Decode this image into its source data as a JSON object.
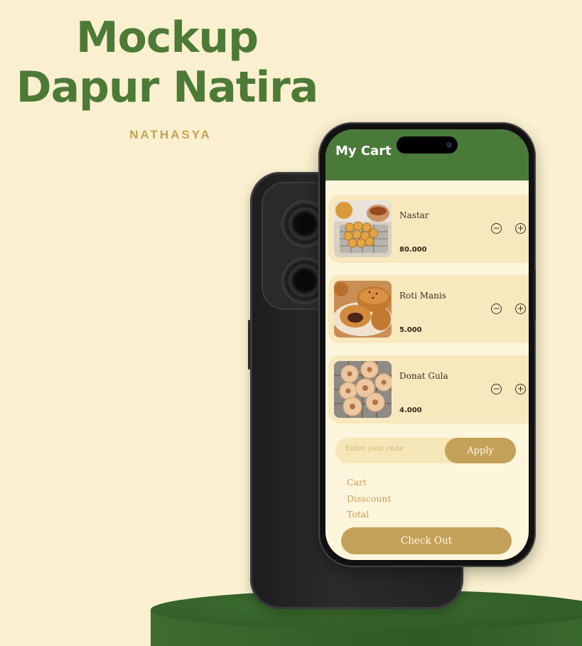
{
  "poster": {
    "title_line1": "Mockup",
    "title_line2": "Dapur Natira",
    "subtitle": "NATHASYA"
  },
  "app": {
    "header_title": "My Cart",
    "cart_items": [
      {
        "name": "Nastar",
        "price": "80.000",
        "image": "nastar-cookies-photo"
      },
      {
        "name": "Roti Manis",
        "price": "5.000",
        "image": "sweet-bread-photo"
      },
      {
        "name": "Donat Gula",
        "price": "4.000",
        "image": "sugar-donut-photo"
      }
    ],
    "quantity_controls": {
      "minus": "−",
      "plus": "+"
    },
    "promo": {
      "placeholder": "Enter your code",
      "apply_label": "Apply"
    },
    "summary": {
      "cart_label": "Cart",
      "discount_label": "Disscount",
      "total_label": "Total"
    },
    "checkout_label": "Check Out"
  },
  "colors": {
    "background": "#faf0cf",
    "brand_green": "#4a7a3a",
    "accent_gold": "#c4a158",
    "card": "#f7e9bd"
  }
}
